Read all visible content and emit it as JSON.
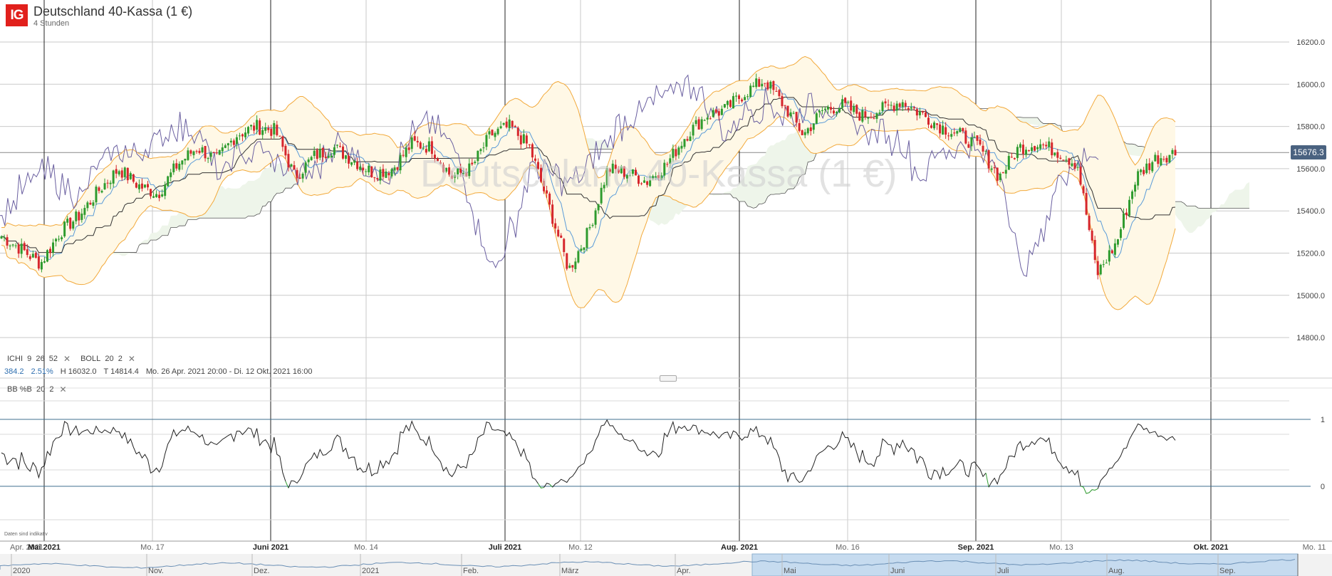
{
  "header": {
    "logo": "IG",
    "title": "Deutschland 40-Kassa (1 €)",
    "interval": "4 Stunden",
    "watermark": "Deutschland 40-Kassa (1 €)"
  },
  "indicators": {
    "ichi": {
      "name": "ICHI",
      "p1": "9",
      "p2": "26",
      "p3": "52"
    },
    "boll": {
      "name": "BOLL",
      "p1": "20",
      "p2": "2"
    },
    "bbpb": {
      "name": "BB %B",
      "p1": "20",
      "p2": "2"
    },
    "close_symbol": "✕"
  },
  "stats": {
    "change": "384.2",
    "change_pct": "2.51%",
    "high": "H 16032.0",
    "low": "T 14814.4",
    "range": "Mo. 26 Apr. 2021 20:00 - Di. 12 Okt. 2021 16:00"
  },
  "note": "Daten sind indikativ",
  "current_price": "15676.3",
  "colors": {
    "up": "#2e9b2e",
    "down": "#d6262c",
    "boll": "#f2a93b",
    "boll_fill": "#fff8e6",
    "tenkan": "#5a9bd8",
    "kijun": "#333333",
    "chikou": "#6a5fa0",
    "cloud": "#eef5ea",
    "accent": "#e1201c"
  },
  "chart_data": {
    "type": "line",
    "main": {
      "y_ticks": [
        "16200.0",
        "16000.0",
        "15800.0",
        "15600.0",
        "15400.0",
        "15200.0",
        "15000.0",
        "14800.0"
      ],
      "ylim": [
        14700,
        16300
      ],
      "current_price": 15676.3,
      "series_close_approx": [
        15280,
        15220,
        15150,
        15300,
        15380,
        15500,
        15600,
        15520,
        15480,
        15620,
        15700,
        15640,
        15760,
        15800,
        15780,
        15560,
        15660,
        15700,
        15640,
        15580,
        15600,
        15720,
        15700,
        15560,
        15600,
        15760,
        15800,
        15700,
        15420,
        15120,
        15300,
        15600,
        15580,
        15540,
        15620,
        15760,
        15850,
        15880,
        15960,
        16020,
        15900,
        15760,
        15880,
        15900,
        15850,
        15880,
        15920,
        15860,
        15800,
        15760,
        15700,
        15560,
        15700,
        15720,
        15680,
        15620,
        15100,
        15250,
        15560,
        15650,
        15676
      ]
    },
    "bbpb": {
      "y_ticks": [
        "1",
        "0"
      ],
      "ylim": [
        -0.35,
        1.35
      ]
    },
    "x_ticks": [
      "Apr. 2021",
      "Mai 2021",
      "Mo. 17",
      "Juni 2021",
      "Mo. 14",
      "Juli 2021",
      "Mo. 12",
      "Aug. 2021",
      "Mo. 16",
      "Sep. 2021",
      "Mo. 13",
      "Okt. 2021",
      "Mo. 11"
    ],
    "navigator_ticks": [
      "2020",
      "Nov.",
      "Dez.",
      "2021",
      "Feb.",
      "März",
      "Apr.",
      "Mai",
      "Juni",
      "Juli",
      "Aug.",
      "Sep."
    ]
  }
}
